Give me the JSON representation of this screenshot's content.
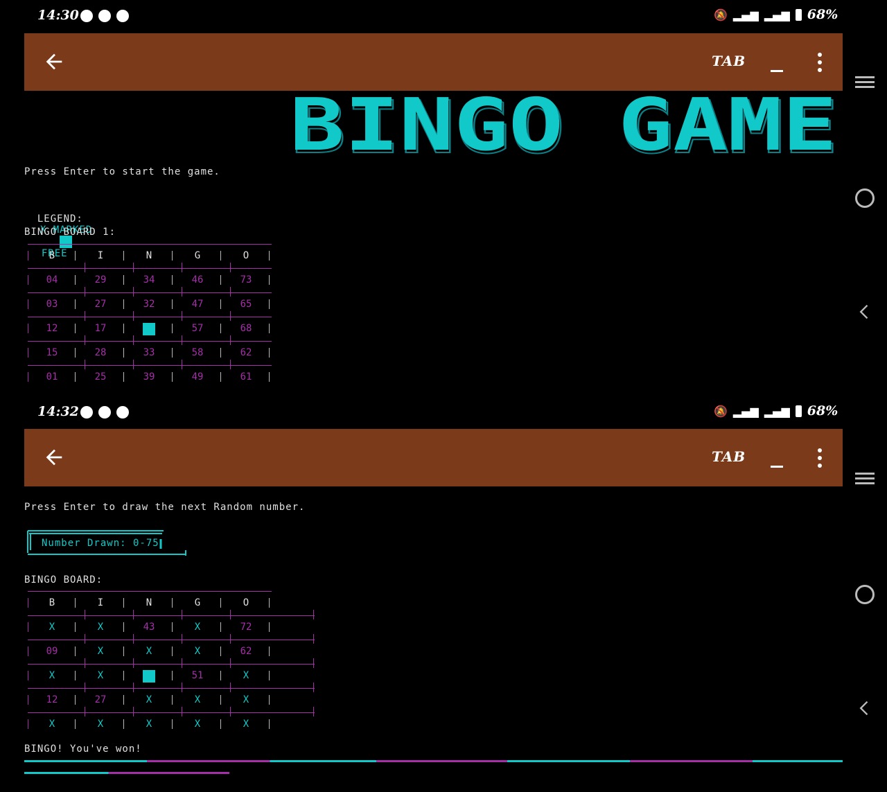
{
  "top": {
    "status": {
      "time": "14:30",
      "battery": "68%"
    },
    "appbar": {
      "tab_label": "TAB"
    },
    "title_art": "BINGO GAME",
    "prompt": "Press Enter to start the game.",
    "legend": {
      "label": "LEGEND:",
      "marked": "X MARKED",
      "free": "FREE"
    },
    "board_title": "BINGO BOARD 1:",
    "board": {
      "headers": [
        "B",
        "I",
        "N",
        "G",
        "O"
      ],
      "rows": [
        [
          "04",
          "29",
          "34",
          "46",
          "73"
        ],
        [
          "03",
          "27",
          "32",
          "47",
          "65"
        ],
        [
          "12",
          "17",
          "FREE",
          "57",
          "68"
        ],
        [
          "15",
          "28",
          "33",
          "58",
          "62"
        ],
        [
          "01",
          "25",
          "39",
          "49",
          "61"
        ]
      ]
    }
  },
  "bottom": {
    "status": {
      "time": "14:32",
      "battery": "68%"
    },
    "appbar": {
      "tab_label": "TAB"
    },
    "prompt": "Press Enter to draw the next Random number.",
    "number_drawn": "Number Drawn: 0-75",
    "board_title": "BINGO BOARD:",
    "board": {
      "headers": [
        "B",
        "I",
        "N",
        "G",
        "O"
      ],
      "rows": [
        [
          "X",
          "X",
          "43",
          "X",
          "72"
        ],
        [
          "09",
          "X",
          "X",
          "X",
          "62"
        ],
        [
          "X",
          "X",
          "FREE",
          "51",
          "X"
        ],
        [
          "12",
          "27",
          "X",
          "X",
          "X"
        ],
        [
          "X",
          "X",
          "X",
          "X",
          "X"
        ]
      ]
    },
    "result": "BINGO! You've won!"
  },
  "colors": {
    "accent": "#12c9c9",
    "grid": "#a42fa8",
    "appbar": "#7b3a19"
  },
  "icons": [
    "back-arrow-icon",
    "more-vert-icon",
    "minimize-icon",
    "menu-icon",
    "home-circle-icon",
    "nav-back-icon",
    "messenger-icon",
    "mute-icon",
    "signal-icon",
    "battery-icon"
  ]
}
